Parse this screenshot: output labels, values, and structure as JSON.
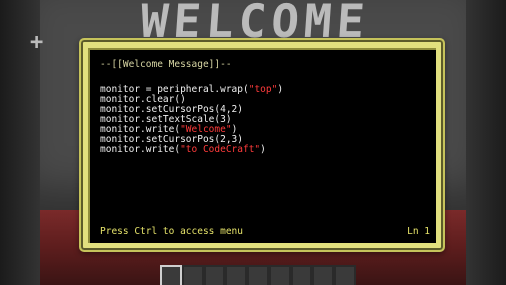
{
  "background": {
    "sign_text": "WELCOME"
  },
  "terminal": {
    "lines": [
      {
        "type": "comment",
        "text": "--[[Welcome Message]]--"
      },
      {
        "type": "code",
        "text": ""
      },
      {
        "type": "code",
        "parts": [
          "monitor = peripheral.wrap(",
          "\"top\"",
          ")"
        ]
      },
      {
        "type": "code",
        "parts": [
          "monitor.clear()"
        ]
      },
      {
        "type": "code",
        "parts": [
          "monitor.setCursorPos(4,2)"
        ]
      },
      {
        "type": "code",
        "parts": [
          "monitor.setTextScale(3)"
        ]
      },
      {
        "type": "code",
        "parts": [
          "monitor.write(",
          "\"Welcome\"",
          ")"
        ]
      },
      {
        "type": "code",
        "parts": [
          "monitor.setCursorPos(2,3)"
        ]
      },
      {
        "type": "code",
        "parts": [
          "monitor.write(",
          "\"to CodeCraft\"",
          ")"
        ]
      }
    ],
    "status_left": "Press Ctrl to access menu",
    "status_right": "Ln 1"
  },
  "colors": {
    "frame": "#e2e07e",
    "string": "#ff3b3b",
    "comment": "#d8d6a4",
    "status": "#e6e36a"
  },
  "hotbar": {
    "slots": 9,
    "active_slot": 1
  }
}
